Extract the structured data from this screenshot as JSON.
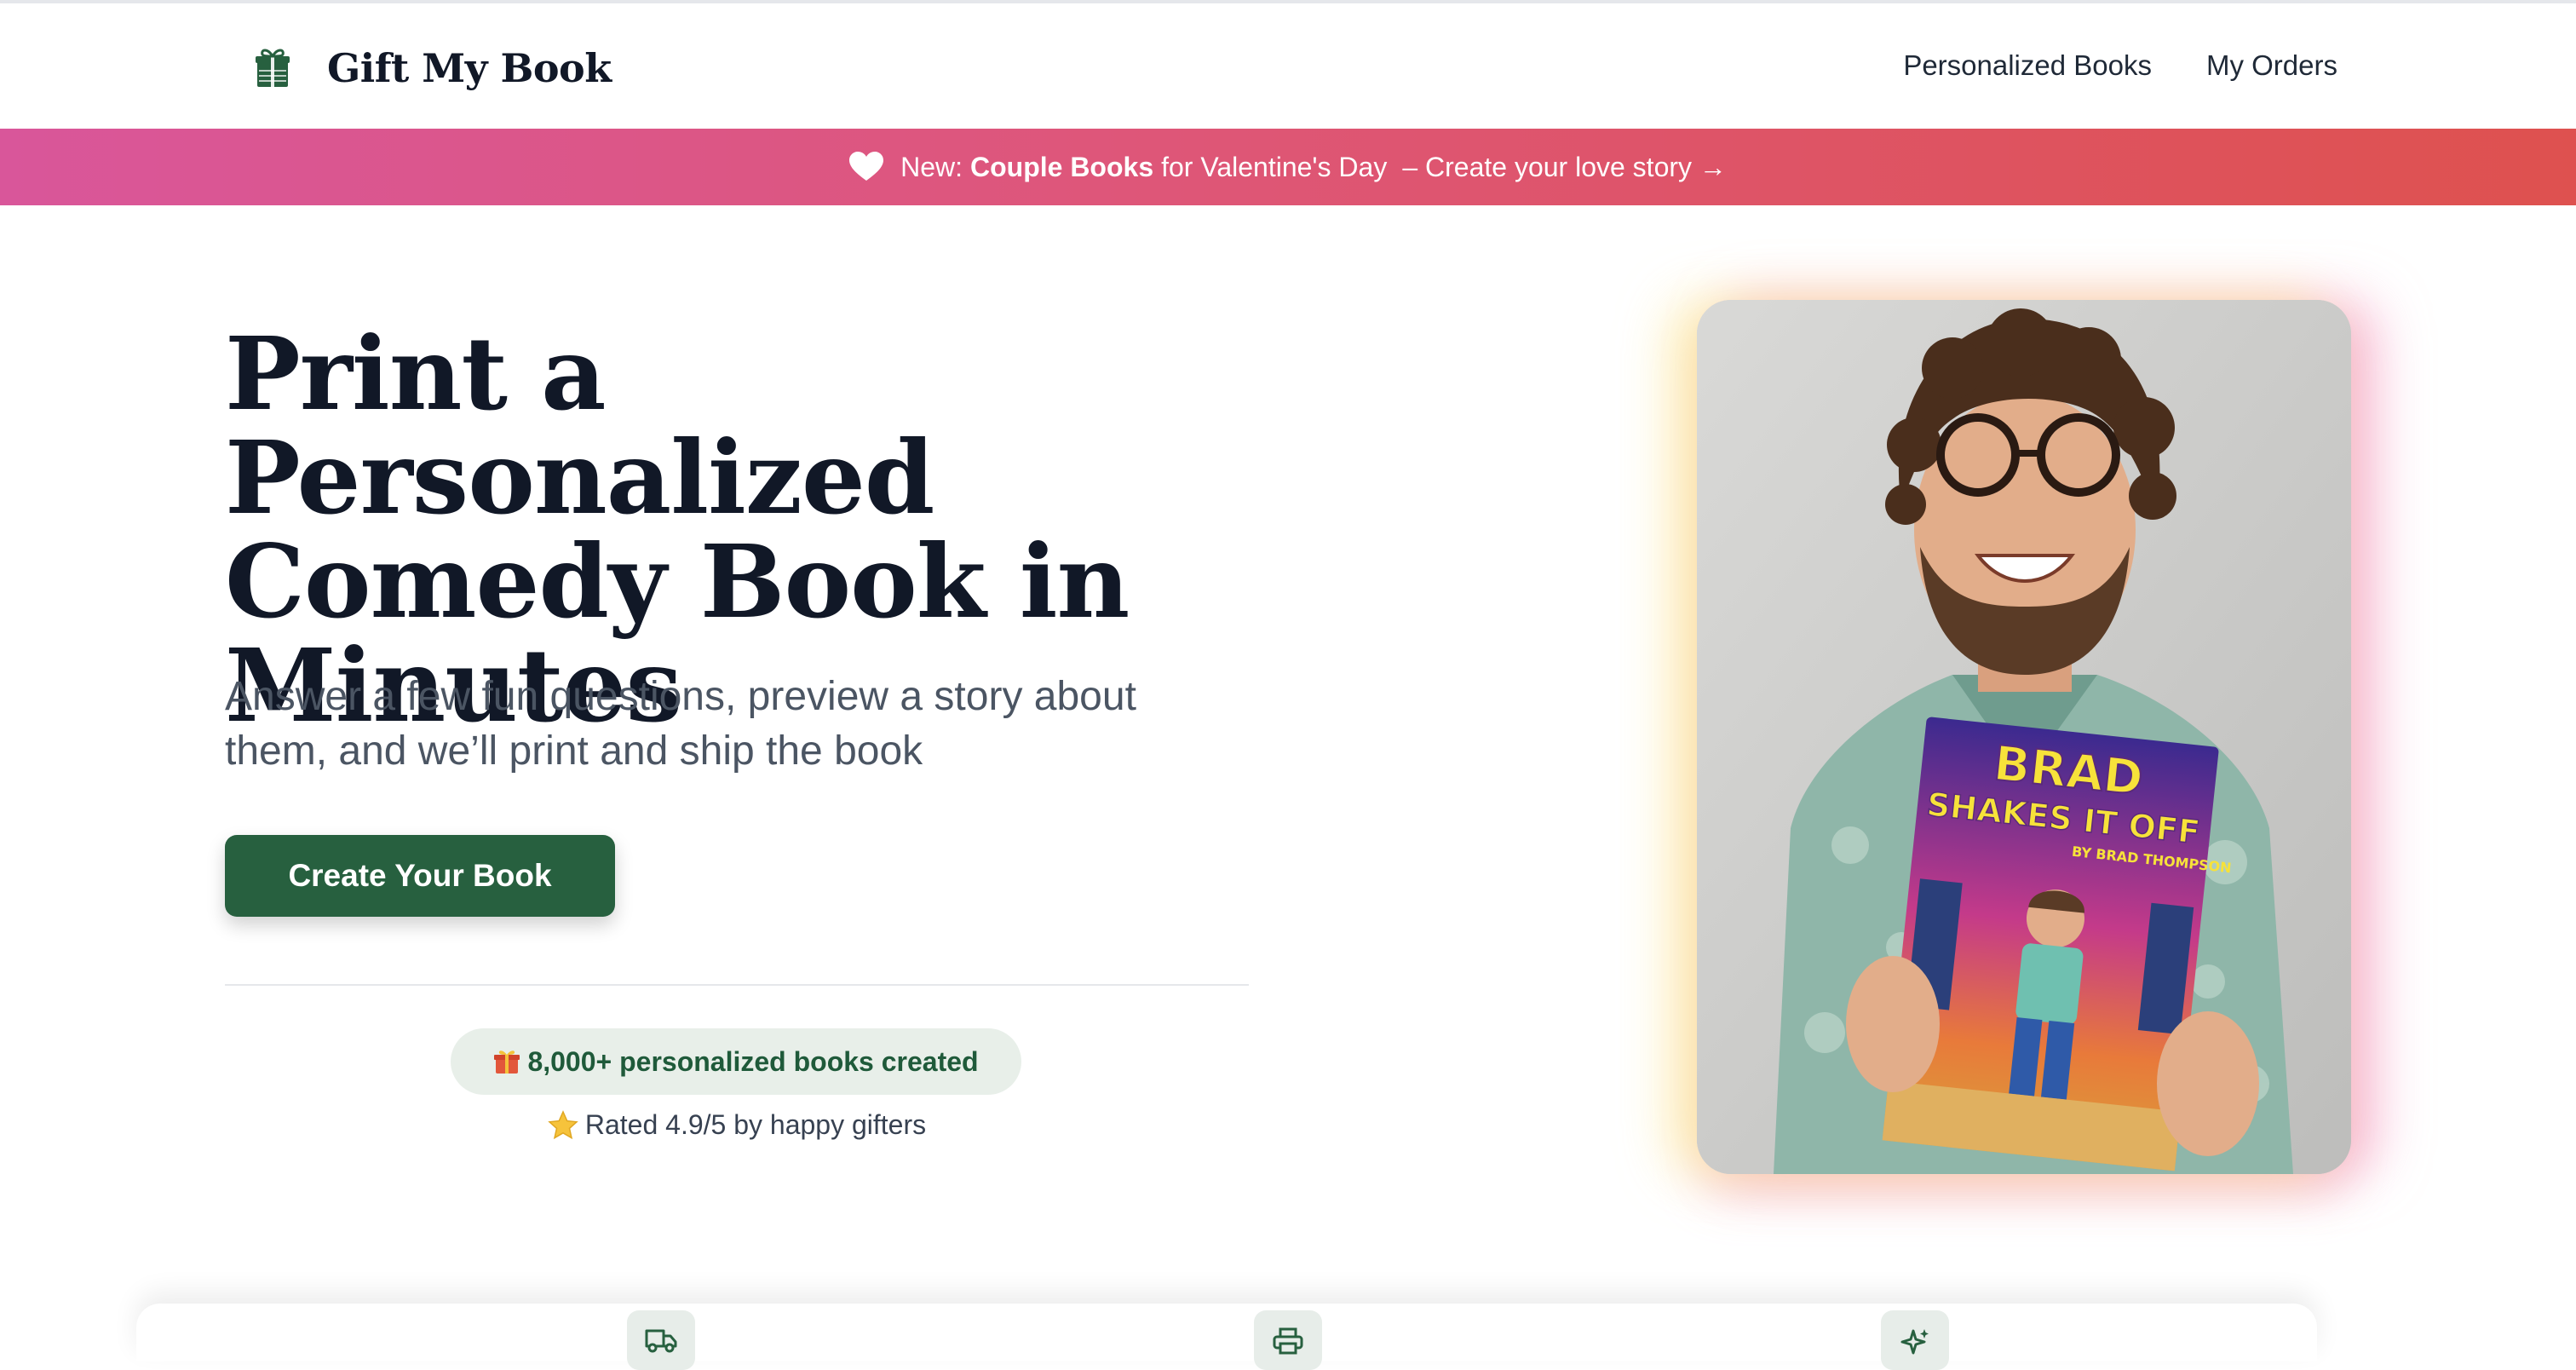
{
  "header": {
    "brand_name": "Gift My Book",
    "brand_icon": "gift-book-icon",
    "nav": [
      {
        "label": "Personalized Books"
      },
      {
        "label": "My Orders"
      }
    ]
  },
  "banner": {
    "icon": "heart-icon",
    "prefix": "New:",
    "highlight": "Couple Books",
    "middle": "for Valentine's Day",
    "link": "– Create your love story →",
    "colors": {
      "start": "#d9569a",
      "end": "#de514f"
    }
  },
  "hero": {
    "title": "Print a Personalized Comedy Book in Minutes",
    "subtitle": "Answer a few fun questions, preview a story about them, and we’ll print and ship the book",
    "cta_label": "Create Your Book",
    "stat_text": "8,000+ personalized books created",
    "stat_icon": "gift-emoji-icon",
    "rating_text": "Rated 4.9/5 by happy gifters",
    "rating_icon": "star-emoji-icon",
    "book_cover": {
      "title_line1": "BRAD",
      "title_line2": "SHAKES IT OFF",
      "author": "BY BRAD THOMPSON"
    }
  },
  "features": [
    {
      "icon": "truck-icon"
    },
    {
      "icon": "printer-icon"
    },
    {
      "icon": "sparkles-icon"
    }
  ],
  "colors": {
    "accent_green": "#27603f",
    "text_dark": "#111827",
    "text_muted": "#4b5563",
    "pill_bg": "#e8efe9"
  }
}
